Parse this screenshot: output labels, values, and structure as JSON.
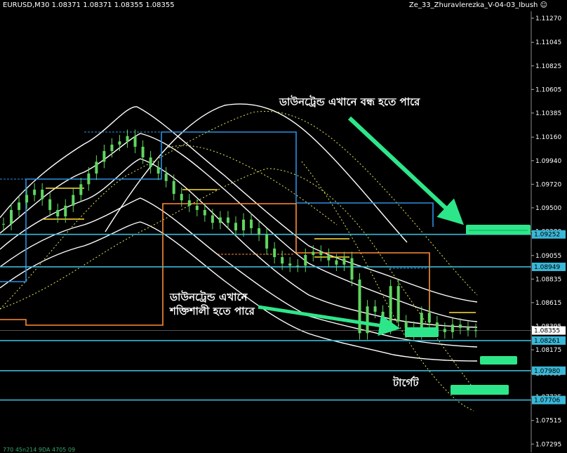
{
  "header": {
    "symbol_line": "EURUSD,M30  1.08371 1.08371 1.08355 1.08355",
    "indicator_label": "Ze_33_Zhuravlerezka_V-04-03_Ibush ☺"
  },
  "annotations": {
    "downtrend_may_end": "ডাউনট্রেন্ড এখানে বন্ধ হতে পারে",
    "downtrend_strong_line1": "ডাউনট্রেন্ড এখানে",
    "downtrend_strong_line2": "শক্তিশালী হতে পারে",
    "target": "টার্গেট"
  },
  "footer": "770 45n214 9DA 4705 09",
  "colors": {
    "background": "#000000",
    "candles": "#5fd65f",
    "horizontal_levels": "#3ab8d8",
    "blue_step_line": "#2c8fe0",
    "orange_step_line": "#ff8c33",
    "yellow_segments": "#ffe033",
    "white_bands": "#ffffff",
    "dotted_envelope": "#e8e85a",
    "arrows": "#2ee68a",
    "price_tag": "#3ab8d8"
  },
  "chart_data": {
    "type": "line",
    "symbol": "EURUSD",
    "timeframe": "M30",
    "y_axis": {
      "ticks": [
        1.1127,
        1.11045,
        1.10825,
        1.10605,
        1.10385,
        1.1016,
        1.0994,
        1.0972,
        1.095,
        1.0928,
        1.09055,
        1.08835,
        1.08615,
        1.08395,
        1.08175,
        1.07955,
        1.07735,
        1.07515,
        1.07295
      ],
      "ylim": [
        1.07218,
        1.11335
      ]
    },
    "current_price": 1.08355,
    "horizontal_levels": [
      1.09252,
      1.08949,
      1.08261,
      1.0798,
      1.07706
    ],
    "price_series": {
      "name": "EURUSD",
      "values": [
        1.0935,
        1.0948,
        1.0955,
        1.0962,
        1.0967,
        1.0958,
        1.0948,
        1.0942,
        1.0952,
        1.0962,
        1.0972,
        1.0982,
        1.0993,
        1.1003,
        1.1009,
        1.1012,
        1.1017,
        1.1007,
        1.0997,
        1.0988,
        1.0982,
        1.0975,
        1.0963,
        1.0957,
        1.0952,
        1.0948,
        1.0943,
        1.0936,
        1.0941,
        1.0936,
        1.0929,
        1.0939,
        1.0931,
        1.0925,
        1.0912,
        1.0904,
        1.0898,
        1.0896,
        1.0896,
        1.0906,
        1.0909,
        1.0906,
        1.0901,
        1.0897,
        1.0903,
        1.0883,
        1.0833,
        1.0858,
        1.0853,
        1.0838,
        1.0877,
        1.0844,
        1.0838,
        1.0833,
        1.0852,
        1.0843,
        1.0837,
        1.0834,
        1.0841,
        1.0838,
        1.0836,
        1.0835
      ]
    }
  }
}
